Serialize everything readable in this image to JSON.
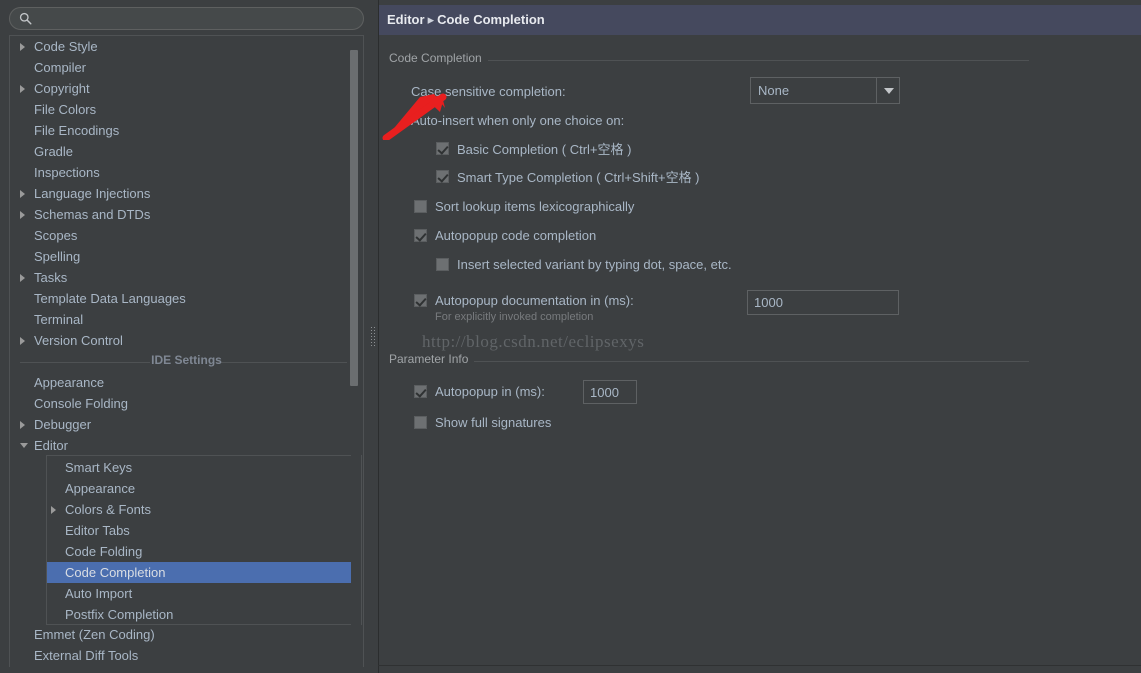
{
  "search": {
    "placeholder": "",
    "value": "",
    "icon": "search-icon"
  },
  "sidebar": {
    "ide_settings_divider": "IDE Settings",
    "items": [
      {
        "label": "Code Style",
        "expandable": true,
        "expanded": false,
        "indent": 0
      },
      {
        "label": "Compiler",
        "expandable": false,
        "expanded": false,
        "indent": 0
      },
      {
        "label": "Copyright",
        "expandable": true,
        "expanded": false,
        "indent": 0
      },
      {
        "label": "File Colors",
        "expandable": false,
        "expanded": false,
        "indent": 0
      },
      {
        "label": "File Encodings",
        "expandable": false,
        "expanded": false,
        "indent": 0
      },
      {
        "label": "Gradle",
        "expandable": false,
        "expanded": false,
        "indent": 0
      },
      {
        "label": "Inspections",
        "expandable": false,
        "expanded": false,
        "indent": 0
      },
      {
        "label": "Language Injections",
        "expandable": true,
        "expanded": false,
        "indent": 0
      },
      {
        "label": "Schemas and DTDs",
        "expandable": true,
        "expanded": false,
        "indent": 0
      },
      {
        "label": "Scopes",
        "expandable": false,
        "expanded": false,
        "indent": 0
      },
      {
        "label": "Spelling",
        "expandable": false,
        "expanded": false,
        "indent": 0
      },
      {
        "label": "Tasks",
        "expandable": true,
        "expanded": false,
        "indent": 0
      },
      {
        "label": "Template Data Languages",
        "expandable": false,
        "expanded": false,
        "indent": 0
      },
      {
        "label": "Terminal",
        "expandable": false,
        "expanded": false,
        "indent": 0
      },
      {
        "label": "Version Control",
        "expandable": true,
        "expanded": false,
        "indent": 0
      }
    ],
    "ide_items": [
      {
        "label": "Appearance",
        "expandable": false,
        "expanded": false,
        "indent": 0
      },
      {
        "label": "Console Folding",
        "expandable": false,
        "expanded": false,
        "indent": 0
      },
      {
        "label": "Debugger",
        "expandable": true,
        "expanded": false,
        "indent": 0
      },
      {
        "label": "Editor",
        "expandable": true,
        "expanded": true,
        "indent": 0
      }
    ],
    "editor_children": [
      {
        "label": "Smart Keys",
        "expandable": false,
        "selected": false
      },
      {
        "label": "Appearance",
        "expandable": false,
        "selected": false
      },
      {
        "label": "Colors & Fonts",
        "expandable": true,
        "selected": false
      },
      {
        "label": "Editor Tabs",
        "expandable": false,
        "selected": false
      },
      {
        "label": "Code Folding",
        "expandable": false,
        "selected": false
      },
      {
        "label": "Code Completion",
        "expandable": false,
        "selected": true
      },
      {
        "label": "Auto Import",
        "expandable": false,
        "selected": false
      },
      {
        "label": "Postfix Completion",
        "expandable": false,
        "selected": false
      }
    ],
    "tail_items": [
      {
        "label": "Emmet (Zen Coding)",
        "expandable": false,
        "expanded": false,
        "indent": 0
      },
      {
        "label": "External Diff Tools",
        "expandable": false,
        "expanded": false,
        "indent": 0
      }
    ]
  },
  "header": {
    "breadcrumb_root": "Editor",
    "breadcrumb_sep": "▸",
    "breadcrumb_leaf": "Code Completion"
  },
  "main": {
    "group_code_completion": "Code Completion",
    "group_parameter_info": "Parameter Info",
    "case_sensitive_label": "Case sensitive completion:",
    "case_sensitive_value": "None",
    "auto_insert_label": "Auto-insert when only one choice on:",
    "basic_completion": "Basic Completion ( Ctrl+空格 )",
    "smart_type_completion": "Smart Type Completion ( Ctrl+Shift+空格 )",
    "sort_lookup": "Sort lookup items lexicographically",
    "autopopup_code_completion": "Autopopup code completion",
    "insert_selected_variant": "Insert selected variant by typing dot, space, etc.",
    "autopopup_documentation": "Autopopup documentation in (ms):",
    "autopopup_documentation_value": "1000",
    "autopopup_documentation_hint": "For explicitly invoked completion",
    "param_autopopup": "Autopopup in (ms):",
    "param_autopopup_value": "1000",
    "show_full_signatures": "Show full signatures"
  },
  "watermark": "http://blog.csdn.net/eclipsexys",
  "colors": {
    "background": "#3c3f41",
    "header_bar": "#45495e",
    "selection": "#4b6eaf",
    "text": "#a9b7c6",
    "annotation_arrow": "#e81f1f"
  }
}
